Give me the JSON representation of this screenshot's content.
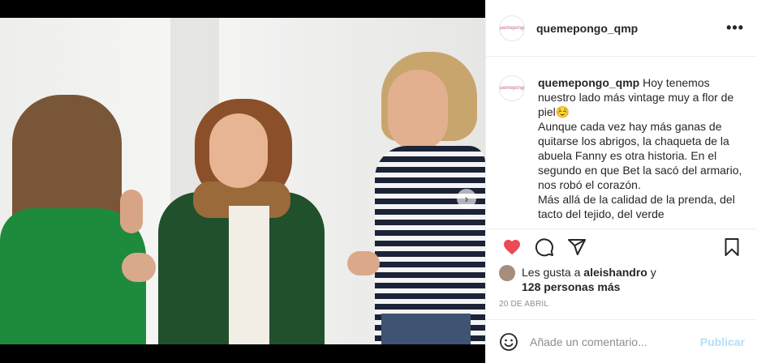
{
  "post": {
    "username": "quemepongo_qmp",
    "avatar_text": "quemepongo",
    "more_label": "•••",
    "next_label": "›"
  },
  "caption": {
    "username": "quemepongo_qmp",
    "line1": " Hoy tenemos nuestro lado más vintage muy a flor de piel☺️",
    "line2": "Aunque cada vez hay más ganas de quitarse los abrigos, la chaqueta de la abuela Fanny es otra historia. En el segundo en que Bet la sacó del armario, nos robó el corazón.",
    "line3": "Más allá de la calidad de la prenda, del tacto del tejido, del verde"
  },
  "likes": {
    "prefix": "Les gusta a ",
    "user": "aleishandro",
    "suffix": " y",
    "others": "128 personas más"
  },
  "date": "20 DE ABRIL",
  "comment": {
    "placeholder": "Añade un comentario...",
    "publish": "Publicar"
  },
  "carousel": {
    "count": 2,
    "active_index": 0
  },
  "colors": {
    "like": "#ed4956",
    "link": "#b2dffc",
    "accent": "#3897f0"
  },
  "icons": [
    "heart-icon",
    "comment-icon",
    "share-icon",
    "bookmark-icon",
    "emoji-icon",
    "more-icon",
    "chevron-right-icon"
  ]
}
